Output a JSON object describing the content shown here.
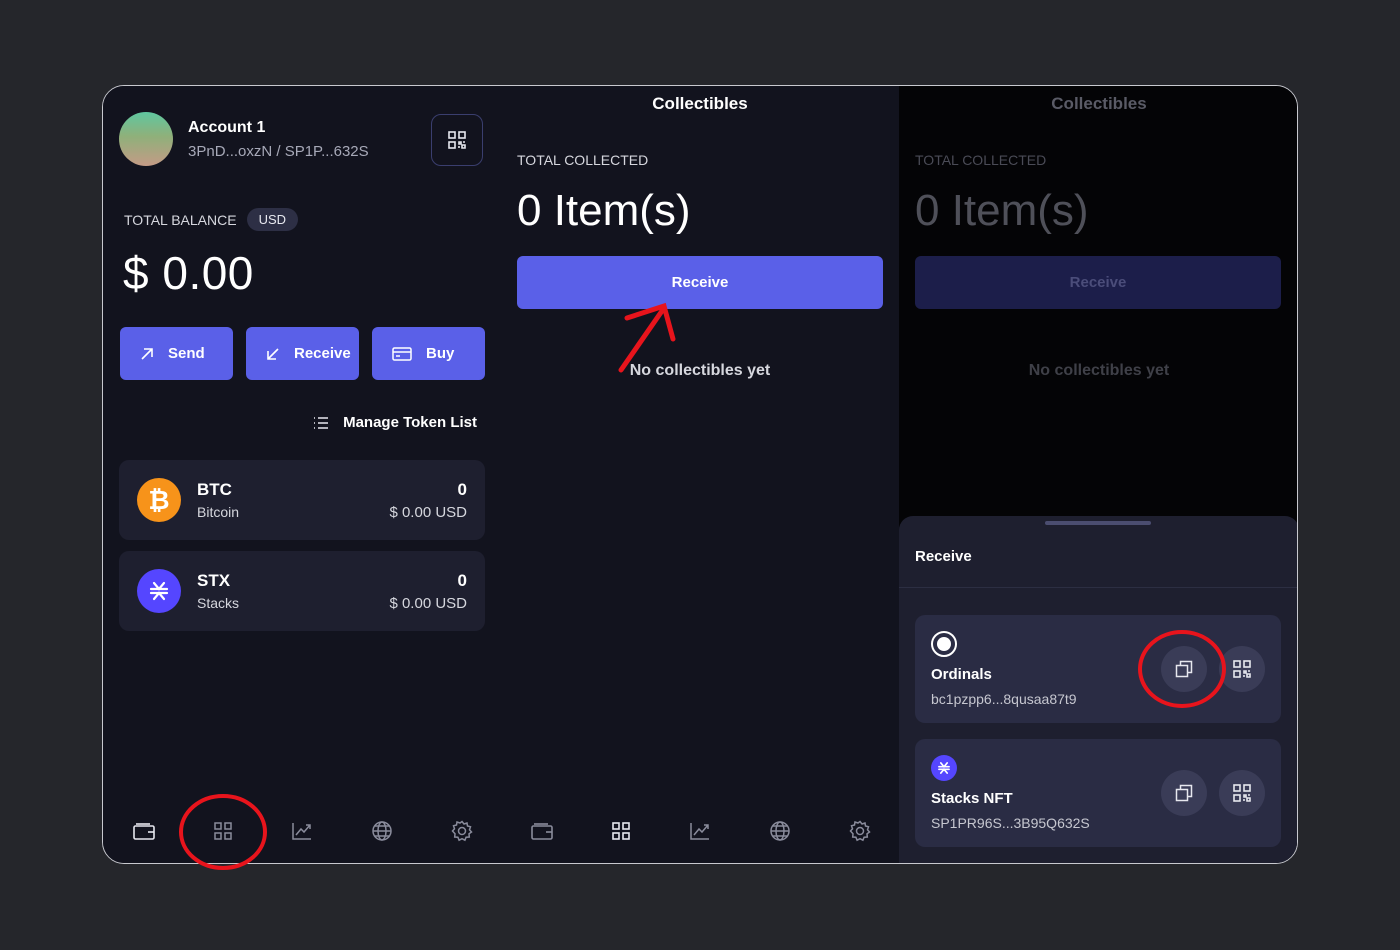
{
  "account": {
    "name": "Account 1",
    "address": "3PnD...oxzN / SP1P...632S"
  },
  "balance": {
    "label": "TOTAL BALANCE",
    "currency": "USD",
    "value": "$ 0.00"
  },
  "actions": [
    {
      "label": "Send",
      "icon": "arrow-up-right-icon"
    },
    {
      "label": "Receive",
      "icon": "arrow-down-left-icon"
    },
    {
      "label": "Buy",
      "icon": "credit-card-icon"
    }
  ],
  "manage_token_list": "Manage Token List",
  "tokens": [
    {
      "symbol": "BTC",
      "name": "Bitcoin",
      "amount": "0",
      "usd": "$ 0.00 USD",
      "color": "#f7931a"
    },
    {
      "symbol": "STX",
      "name": "Stacks",
      "amount": "0",
      "usd": "$ 0.00 USD",
      "color": "#5546ff"
    }
  ],
  "collectibles": {
    "title": "Collectibles",
    "total_label": "TOTAL COLLECTED",
    "total_value": "0 Item(s)",
    "receive_label": "Receive",
    "empty_text": "No collectibles yet"
  },
  "receive_sheet": {
    "title": "Receive",
    "options": [
      {
        "name": "Ordinals",
        "address": "bc1pzpp6...8qusaa87t9"
      },
      {
        "name": "Stacks NFT",
        "address": "SP1PR96S...3B95Q632S"
      }
    ]
  },
  "nav": [
    "wallet-icon",
    "collectibles-grid-icon",
    "chart-icon",
    "globe-icon",
    "settings-gear-icon"
  ],
  "colors": {
    "accent": "#5a60e8",
    "background": "#12131e",
    "card": "#1e1f2f",
    "annotation": "#e8141c"
  }
}
